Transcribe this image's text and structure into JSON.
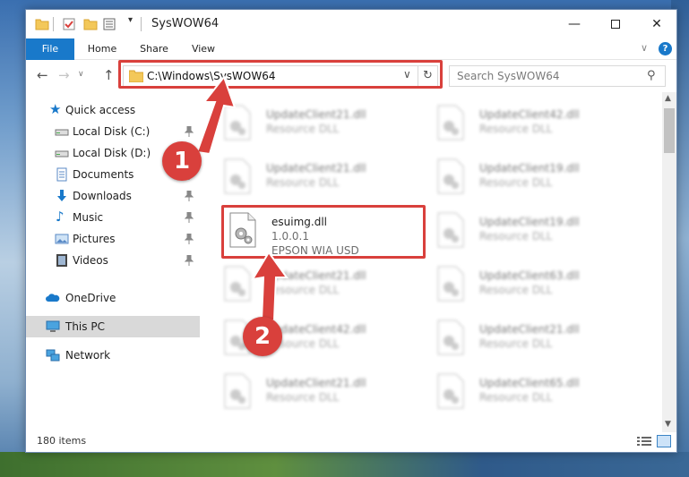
{
  "window": {
    "title": "SysWOW64",
    "controls": {
      "minimize": "—",
      "close": "✕"
    }
  },
  "ribbon": {
    "tabs": [
      "File",
      "Home",
      "Share",
      "View"
    ],
    "help": "?"
  },
  "nav": {
    "address": "C:\\Windows\\SysWOW64",
    "search_placeholder": "Search SysWOW64"
  },
  "sidebar": {
    "items": [
      {
        "label": "Quick access",
        "icon": "star-icon"
      },
      {
        "label": "Local Disk (C:)",
        "icon": "drive-icon"
      },
      {
        "label": "Local Disk (D:)",
        "icon": "drive-icon"
      },
      {
        "label": "Documents",
        "icon": "documents-icon"
      },
      {
        "label": "Downloads",
        "icon": "downloads-icon"
      },
      {
        "label": "Music",
        "icon": "music-icon"
      },
      {
        "label": "Pictures",
        "icon": "pictures-icon"
      },
      {
        "label": "Videos",
        "icon": "videos-icon"
      },
      {
        "label": "OneDrive",
        "icon": "cloud-icon"
      },
      {
        "label": "This PC",
        "icon": "computer-icon"
      },
      {
        "label": "Network",
        "icon": "network-icon"
      }
    ],
    "selected": "This PC"
  },
  "files": [
    {
      "name": "UpdateClient21.dll",
      "desc": "Resource DLL"
    },
    {
      "name": "UpdateClient42.dll",
      "desc": "Resource DLL"
    },
    {
      "name": "UpdateClient21.dll",
      "desc": "Resource DLL"
    },
    {
      "name": "UpdateClient19.dll",
      "desc": "Resource DLL"
    },
    {
      "name": "esuimg.dll",
      "version": "1.0.0.1",
      "company": "EPSON WIA USD"
    },
    {
      "name": "UpdateClient19.dll",
      "desc": "Resource DLL"
    },
    {
      "name": "UpdateClient21.dll",
      "desc": "Resource DLL"
    },
    {
      "name": "UpdateClient63.dll",
      "desc": "Resource DLL"
    },
    {
      "name": "UpdateClient42.dll",
      "desc": "Resource DLL"
    },
    {
      "name": "UpdateClient21.dll",
      "desc": "Resource DLL"
    },
    {
      "name": "UpdateClient21.dll",
      "desc": "Resource DLL"
    },
    {
      "name": "UpdateClient65.dll",
      "desc": "Resource DLL"
    }
  ],
  "status": {
    "item_count": "180 items"
  },
  "annotations": {
    "step1": "1",
    "step2": "2",
    "highlight_color": "#d9403c"
  },
  "colors": {
    "accent": "#1979ca",
    "selected": "#d9d9d9"
  }
}
